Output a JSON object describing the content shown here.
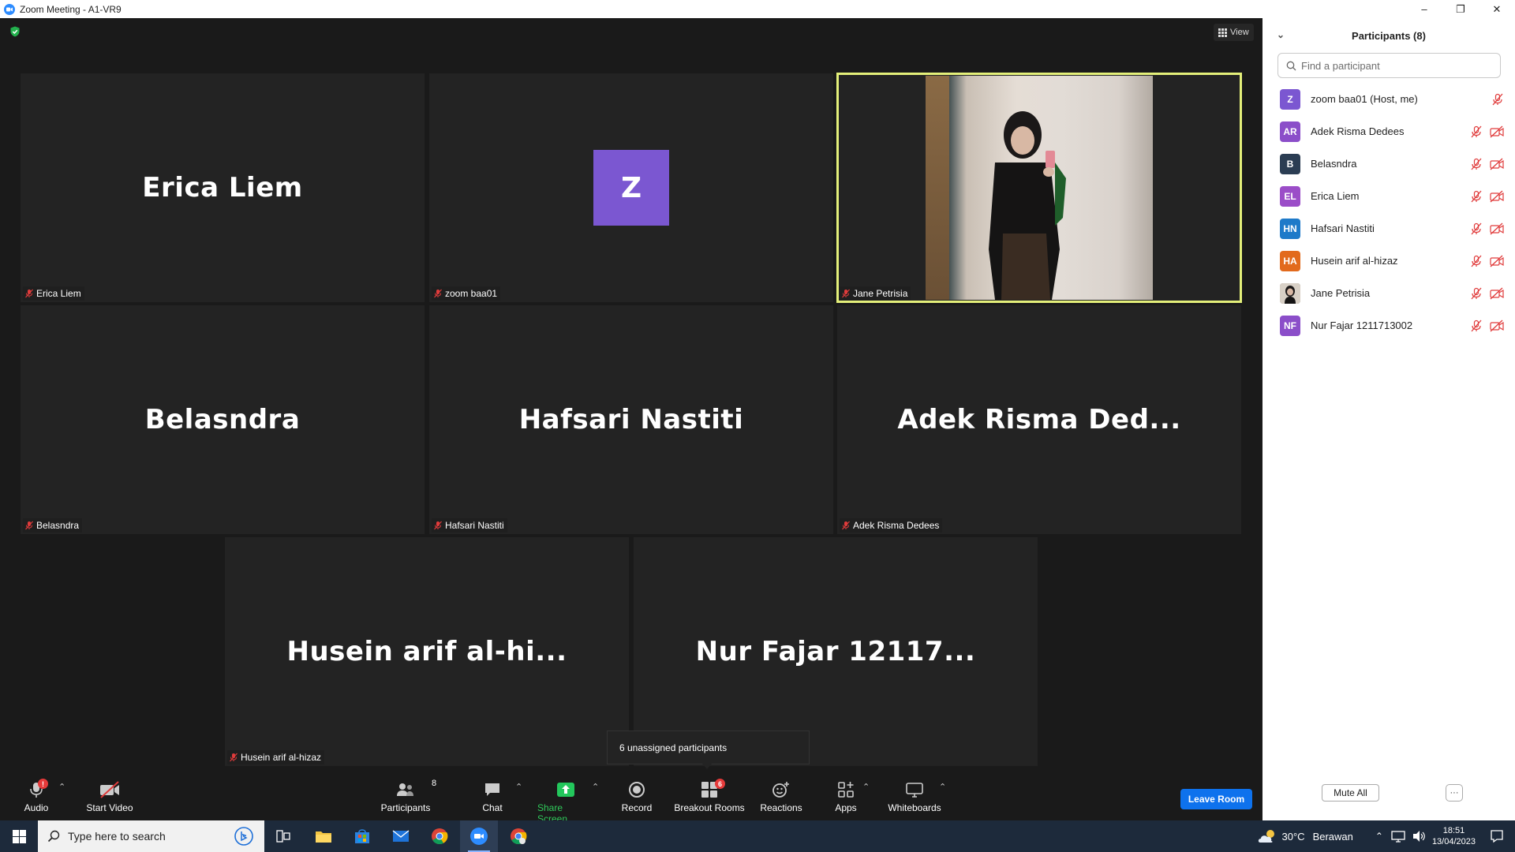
{
  "window": {
    "title": "Zoom Meeting - A1-VR9",
    "minimize": "–",
    "restore": "❐",
    "close": "✕"
  },
  "meeting": {
    "view_label": "View",
    "tiles": [
      {
        "big_name": "Erica Liem",
        "label": "Erica Liem"
      },
      {
        "avatar_letter": "Z",
        "label": "zoom baa01"
      },
      {
        "label": "Jane Petrisia"
      },
      {
        "big_name": "Belasndra",
        "label": "Belasndra"
      },
      {
        "big_name": "Hafsari Nastiti",
        "label": "Hafsari Nastiti"
      },
      {
        "big_name": "Adek Risma Ded...",
        "label": "Adek Risma Dedees"
      },
      {
        "big_name": "Husein arif al-hi...",
        "label": "Husein arif al-hizaz"
      },
      {
        "big_name": "Nur Fajar 12117...",
        "label": ""
      }
    ],
    "tooltip": "6 unassigned participants"
  },
  "toolbar": {
    "audio": "Audio",
    "start_video": "Start Video",
    "participants": "Participants",
    "participants_count": "8",
    "chat": "Chat",
    "share_screen": "Share Screen",
    "record": "Record",
    "breakout_rooms": "Breakout Rooms",
    "breakout_count": "6",
    "reactions": "Reactions",
    "apps": "Apps",
    "whiteboards": "Whiteboards",
    "leave_room": "Leave Room"
  },
  "panel": {
    "title": "Participants (8)",
    "search_placeholder": "Find a participant",
    "participants": [
      {
        "initials": "Z",
        "name": "zoom baa01 (Host, me)",
        "color": "#7b57d1"
      },
      {
        "initials": "AR",
        "name": "Adek Risma Dedees",
        "color": "#8b4ec9"
      },
      {
        "initials": "B",
        "name": "Belasndra",
        "color": "#2b3d53"
      },
      {
        "initials": "EL",
        "name": "Erica Liem",
        "color": "#9b4dc8"
      },
      {
        "initials": "HN",
        "name": "Hafsari Nastiti",
        "color": "#1e7ac9"
      },
      {
        "initials": "HA",
        "name": "Husein arif al-hizaz",
        "color": "#e26a1d"
      },
      {
        "initials": "",
        "name": "Jane Petrisia",
        "color": "#8a7a6e"
      },
      {
        "initials": "NF",
        "name": "Nur Fajar 1211713002",
        "color": "#8b4ec9"
      }
    ],
    "mute_all": "Mute All",
    "more": "···"
  },
  "taskbar": {
    "search_placeholder": "Type here to search",
    "weather_temp": "30°C",
    "weather_desc": "Berawan",
    "time": "18:51",
    "date": "13/04/2023"
  }
}
